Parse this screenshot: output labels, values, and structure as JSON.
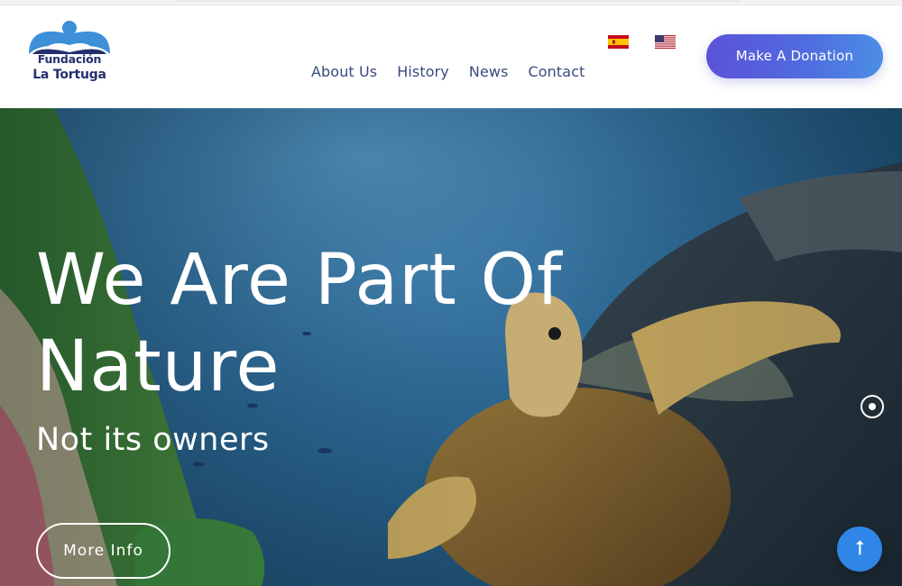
{
  "brand": {
    "name_line1": "Fundación",
    "name_line2": "La Tortuga",
    "logo_color": "#23306e",
    "logo_accent": "#3d8fd8"
  },
  "nav": {
    "items": [
      {
        "label": "About Us"
      },
      {
        "label": "History"
      },
      {
        "label": "News"
      },
      {
        "label": "Contact"
      }
    ]
  },
  "languages": [
    {
      "icon": "flag-spain-icon"
    },
    {
      "icon": "flag-usa-icon"
    }
  ],
  "header": {
    "donate_label": "Make A Donation",
    "donate_colors": [
      "#5a52d8",
      "#4b8fe6"
    ]
  },
  "hero": {
    "title": "We Are Part Of Nature",
    "subtitle": "Not its owners",
    "cta_label": "More Info",
    "slide_indicator_icon": "slide-dot-icon",
    "scroll_top_icon": "arrow-up-icon",
    "scroll_top_color": "#2f86e6"
  }
}
